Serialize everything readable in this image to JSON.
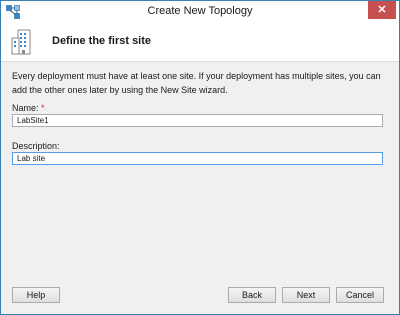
{
  "window": {
    "title": "Create New Topology",
    "close_glyph": "✕"
  },
  "header": {
    "title": "Define the first site",
    "icon": "building-icon"
  },
  "content": {
    "description": "Every deployment must have at least one site. If your deployment has multiple sites, you can add the other ones later by using the New Site wizard.",
    "name_label": "Name:",
    "name_required_marker": "*",
    "name_value": "LabSite1",
    "description_label": "Description:",
    "description_value": "Lab site"
  },
  "buttons": {
    "help": "Help",
    "back": "Back",
    "next": "Next",
    "cancel": "Cancel"
  },
  "colors": {
    "accent": "#3c7fb1",
    "close_button": "#c75050",
    "required": "#d22a2a"
  }
}
